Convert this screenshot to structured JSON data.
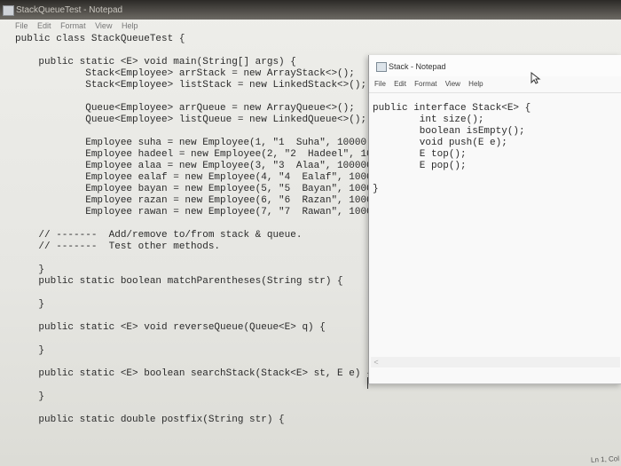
{
  "main_window": {
    "title": "StackQueueTest - Notepad",
    "menu": [
      "File",
      "Edit",
      "Format",
      "View",
      "Help"
    ],
    "code_lines": [
      "public class StackQueueTest {",
      "",
      "    public static <E> void main(String[] args) {",
      "            Stack<Employee> arrStack = new ArrayStack<>();",
      "            Stack<Employee> listStack = new LinkedStack<>();",
      "",
      "            Queue<Employee> arrQueue = new ArrayQueue<>();",
      "            Queue<Employee> listQueue = new LinkedQueue<>();",
      "",
      "            Employee suha = new Employee(1, \"1  Suha\", 10000)",
      "            Employee hadeel = new Employee(2, \"2  Hadeel\", 10",
      "            Employee alaa = new Employee(3, \"3  Alaa\", 100000",
      "            Employee ealaf = new Employee(4, \"4  Ealaf\", 1000",
      "            Employee bayan = new Employee(5, \"5  Bayan\", 1000",
      "            Employee razan = new Employee(6, \"6  Razan\", 1000",
      "            Employee rawan = new Employee(7, \"7  Rawan\", 1000",
      "",
      "    // -------  Add/remove to/from stack & queue.",
      "    // -------  Test other methods.",
      "",
      "    }",
      "    public static boolean matchParentheses(String str) {",
      "",
      "    }",
      "",
      "    public static <E> void reverseQueue(Queue<E> q) {",
      "",
      "    }",
      "",
      "    public static <E> boolean searchStack(Stack<E> st, E e) {",
      "",
      "    }",
      "",
      "    public static double postfix(String str) {"
    ],
    "status": "Ln 1, Col"
  },
  "stack_window": {
    "title": "Stack - Notepad",
    "menu": [
      "File",
      "Edit",
      "Format",
      "View",
      "Help"
    ],
    "code_lines": [
      "public interface Stack<E> {",
      "        int size();",
      "        boolean isEmpty();",
      "        void push(E e);",
      "        E top();",
      "        E pop();",
      "",
      "}"
    ],
    "scroll_left": "<"
  },
  "icons": {
    "notepad": "notepad-icon",
    "cursor": "mouse-pointer-icon"
  }
}
